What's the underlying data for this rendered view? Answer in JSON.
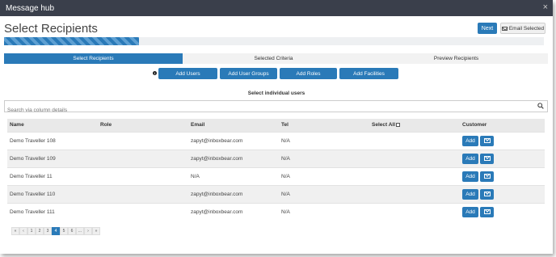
{
  "window": {
    "title": "Message hub",
    "close_glyph": "×"
  },
  "header": {
    "title": "Select Recipients",
    "next_label": "Next",
    "email_selected_label": "Email Selected"
  },
  "progress": {
    "fraction": 0.25
  },
  "tabs": [
    {
      "label": "Select Recipients",
      "active": true
    },
    {
      "label": "Selected Criteria",
      "active": false
    },
    {
      "label": "Preview Recipients",
      "active": false
    }
  ],
  "actions": {
    "info_glyph": "i",
    "add_users": "Add Users",
    "add_user_groups": "Add User Groups",
    "add_roles": "Add Roles",
    "add_facilities": "Add Facilities"
  },
  "section_title": "Select individual users",
  "search": {
    "placeholder": "Search via column details",
    "value": ""
  },
  "table": {
    "headers": {
      "name": "Name",
      "role": "Role",
      "email": "Email",
      "tel": "Tel",
      "select_all": "Select All",
      "customer": "Customer"
    },
    "rows": [
      {
        "name": "Demo Traveller 108",
        "role": "",
        "email": "zapyt@inboxbear.com",
        "tel": "N/A"
      },
      {
        "name": "Demo Traveller 109",
        "role": "",
        "email": "zapyt@inboxbear.com",
        "tel": "N/A"
      },
      {
        "name": "Demo Traveller 11",
        "role": "",
        "email": "N/A",
        "tel": "N/A"
      },
      {
        "name": "Demo Traveller 110",
        "role": "",
        "email": "zapyt@inboxbear.com",
        "tel": "N/A"
      },
      {
        "name": "Demo Traveller 111",
        "role": "",
        "email": "zapyt@inboxbear.com",
        "tel": "N/A"
      }
    ],
    "row_add_label": "Add"
  },
  "pagination": {
    "items": [
      "«",
      "‹",
      "1",
      "2",
      "3",
      "4",
      "5",
      "6",
      "...",
      "›",
      "»"
    ],
    "active": "4"
  },
  "colors": {
    "accent": "#2a7ab8",
    "titlebar": "#3a3f4b"
  }
}
